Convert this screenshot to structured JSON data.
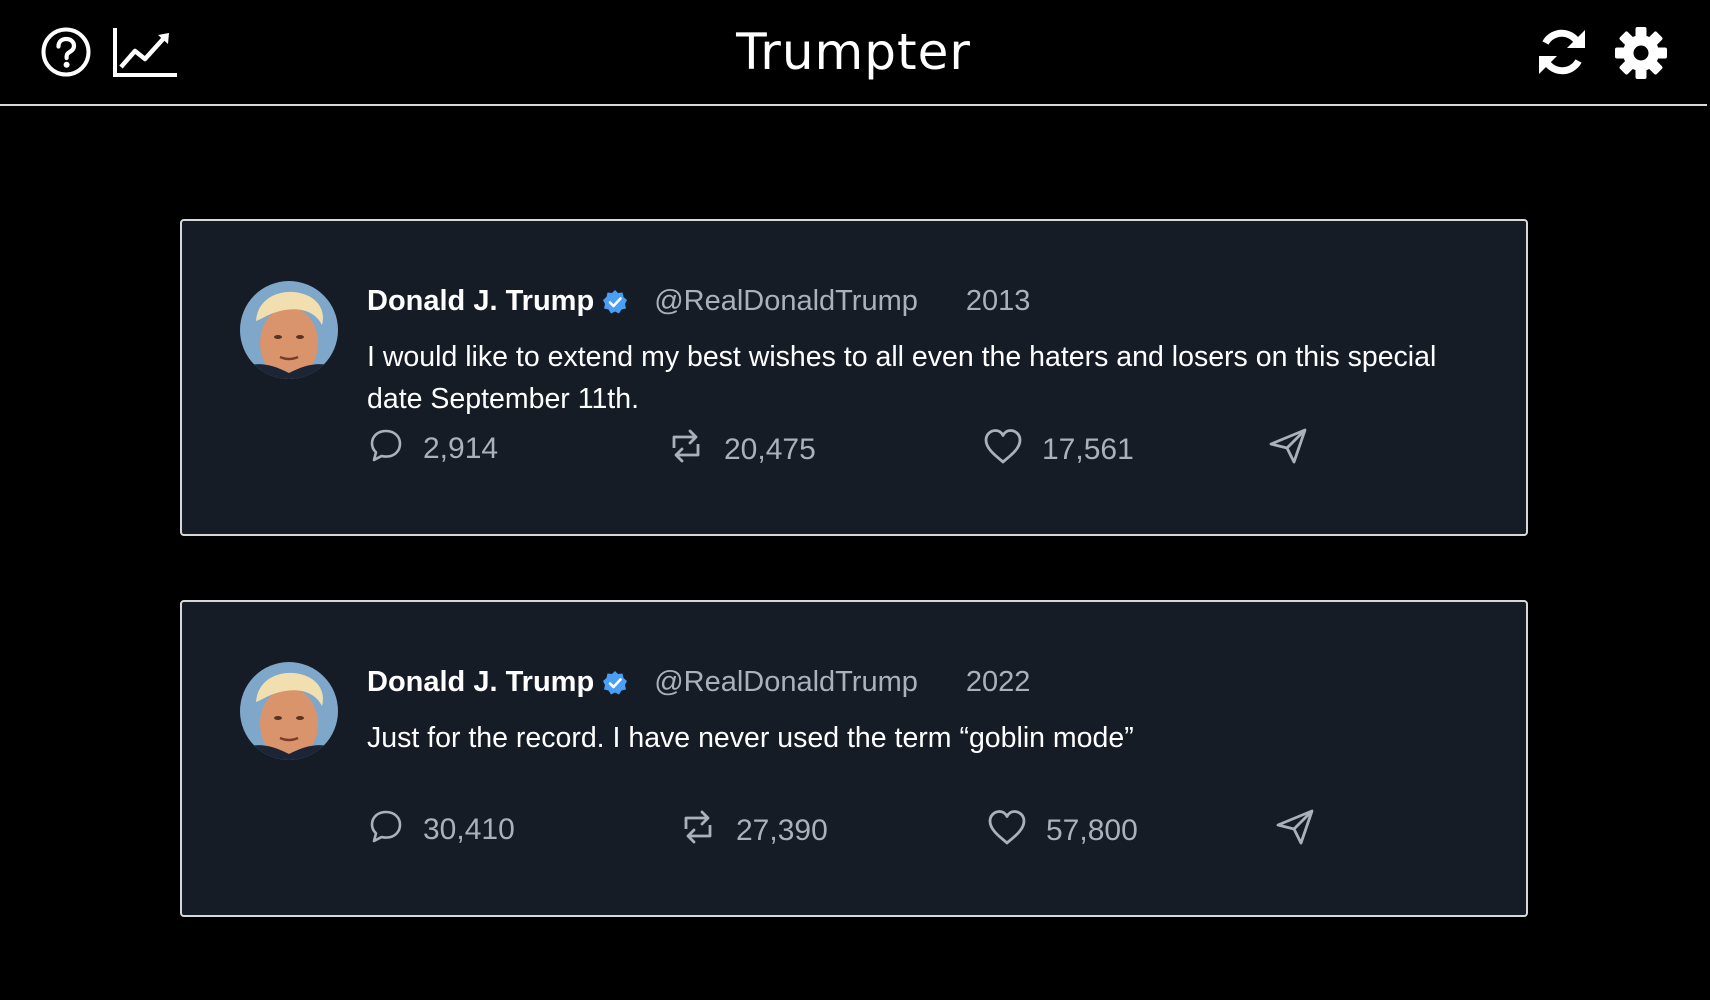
{
  "app": {
    "title": "Trumpter",
    "colors": {
      "background": "#000000",
      "card": "#151c25",
      "border": "#d8d8d8",
      "muted": "#a9b1ba",
      "verified": "#4a9ff5"
    }
  },
  "topbar": {
    "left_icons": [
      "help-icon",
      "stats-chart-icon"
    ],
    "right_icons": [
      "refresh-icon",
      "settings-gear-icon"
    ]
  },
  "tweets": [
    {
      "name": "Donald J. Trump",
      "handle": "@RealDonaldTrump",
      "year": "2013",
      "text": "I would like to extend my best wishes to all even the haters and losers on this special date September 11th.",
      "replies": "2,914",
      "retweets": "20,475",
      "likes": "17,561"
    },
    {
      "name": "Donald J. Trump",
      "handle": "@RealDonaldTrump",
      "year": "2022",
      "text": "Just for the record. I have never used the term “goblin mode”",
      "replies": "30,410",
      "retweets": "27,390",
      "likes": "57,800"
    }
  ]
}
